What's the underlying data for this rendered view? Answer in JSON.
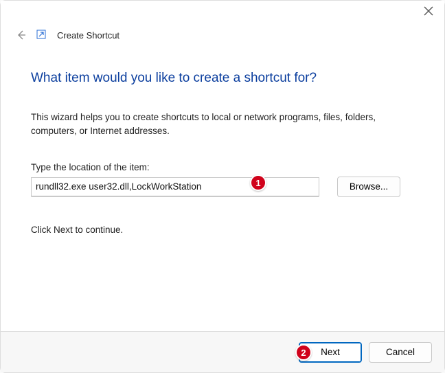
{
  "window": {
    "title": "Create Shortcut"
  },
  "main": {
    "heading": "What item would you like to create a shortcut for?",
    "description": "This wizard helps you to create shortcuts to local or network programs, files, folders, computers, or Internet addresses.",
    "field_label": "Type the location of the item:",
    "location_value": "rundll32.exe user32.dll,LockWorkStation",
    "browse_label": "Browse...",
    "continue_text": "Click Next to continue."
  },
  "footer": {
    "next_label": "Next",
    "cancel_label": "Cancel"
  },
  "annotations": {
    "a1": "1",
    "a2": "2"
  }
}
